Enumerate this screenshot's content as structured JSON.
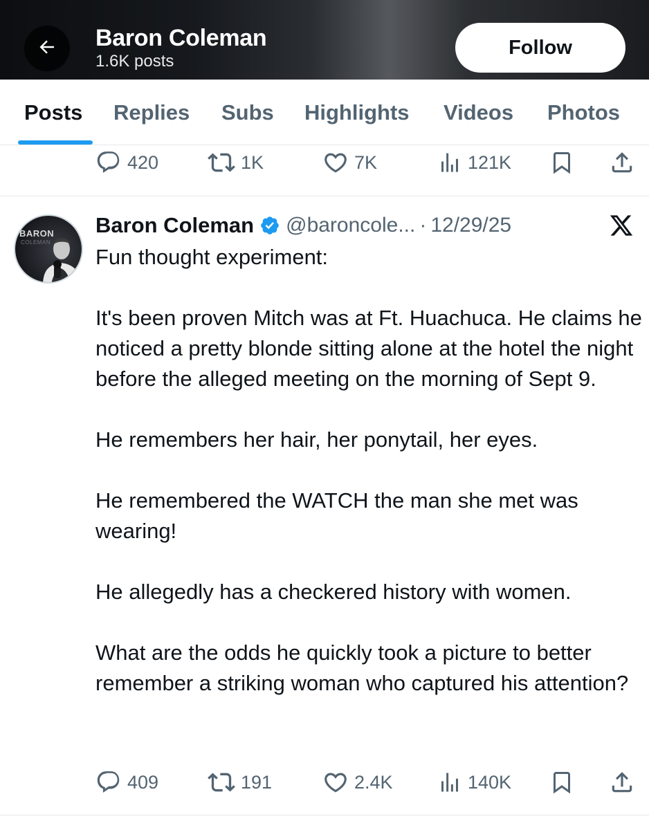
{
  "header": {
    "title": "Baron Coleman",
    "subtitle": "1.6K posts",
    "follow_label": "Follow"
  },
  "tabs": [
    {
      "label": "Posts",
      "active": true
    },
    {
      "label": "Replies",
      "active": false
    },
    {
      "label": "Subs",
      "active": false
    },
    {
      "label": "Highlights",
      "active": false
    },
    {
      "label": "Videos",
      "active": false
    },
    {
      "label": "Photos",
      "active": false
    }
  ],
  "previous_post": {
    "replies": "420",
    "reposts": "1K",
    "likes": "7K",
    "views": "121K"
  },
  "post": {
    "author": "Baron Coleman",
    "handle": "@baroncole...",
    "separator": "·",
    "date": "12/29/25",
    "avatar_text_top": "BARON",
    "avatar_text_bottom": "COLEMAN",
    "paragraphs": [
      "Fun thought experiment:",
      "It's been proven Mitch was at Ft. Huachuca. He claims he noticed a pretty blonde sitting alone at the hotel the night before the alleged meeting on the morning of Sept 9.",
      "He remembers her hair, her ponytail, her eyes.",
      "He remembered the WATCH the man she met was wearing!",
      "He allegedly has a checkered history with women.",
      "What are the odds he quickly took a picture to better remember a striking woman who captured his attention?"
    ],
    "replies": "409",
    "reposts": "191",
    "likes": "2.4K",
    "views": "140K"
  },
  "icons": {
    "back": "arrow-left-icon",
    "verified": "verified-badge-icon",
    "x_logo": "x-logo-icon",
    "reply": "reply-icon",
    "repost": "repost-icon",
    "like": "heart-icon",
    "views": "views-icon",
    "bookmark": "bookmark-icon",
    "share": "share-icon"
  },
  "colors": {
    "accent": "#1d9bf0",
    "text_primary": "#0f1419",
    "text_secondary": "#536471",
    "verified": "#1d9bf0"
  }
}
